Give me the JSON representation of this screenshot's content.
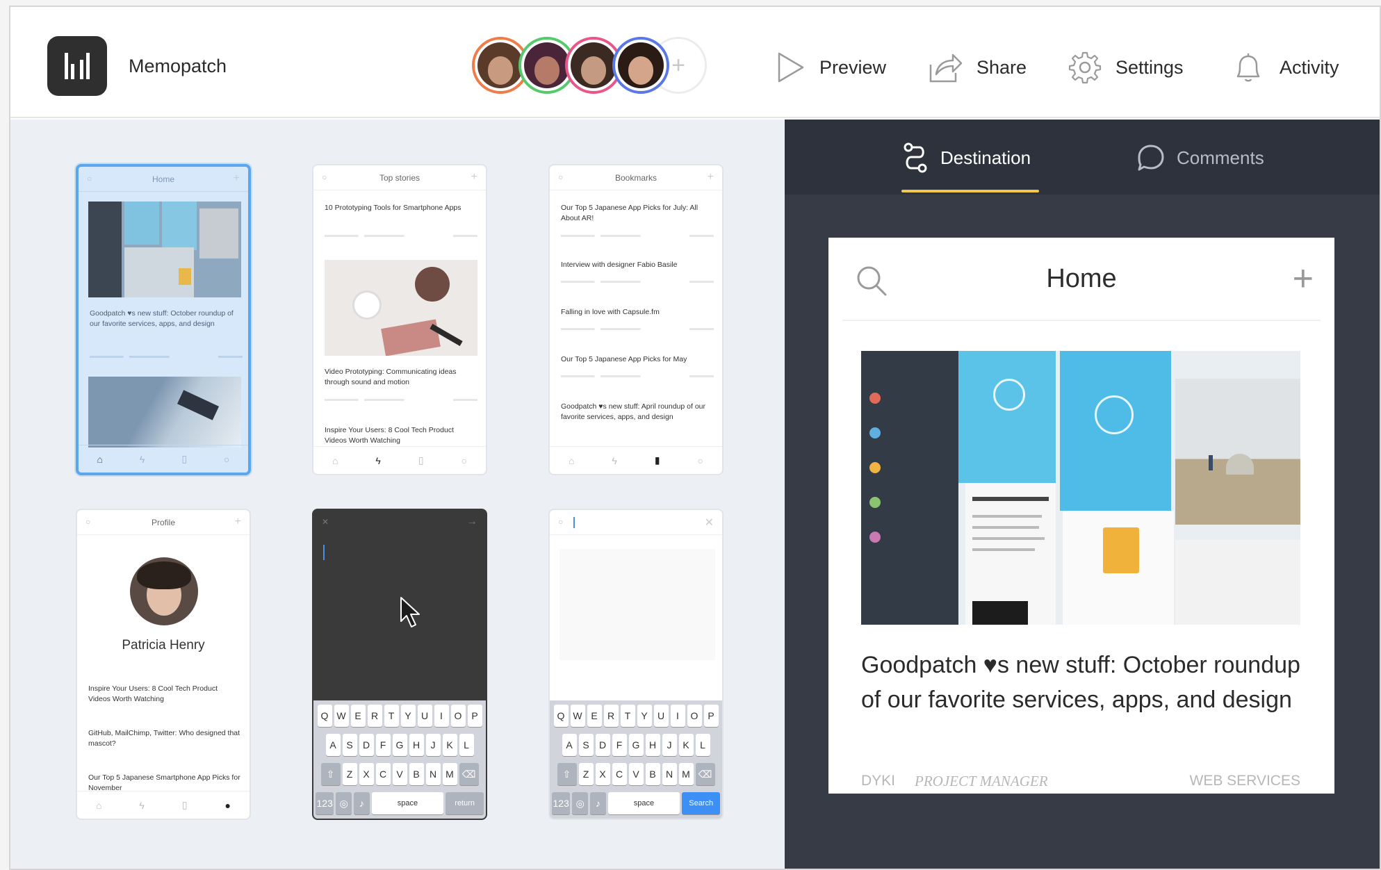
{
  "app": {
    "name": "Memopatch"
  },
  "toolbar": {
    "preview": "Preview",
    "share": "Share",
    "settings": "Settings",
    "activity": "Activity",
    "add_collaborator": "+"
  },
  "collaborators": [
    {
      "ring": "#ee7d4a",
      "skin": "#c89a80",
      "hair": "#5a3b2a"
    },
    {
      "ring": "#55c96b",
      "skin": "#b57a68",
      "hair": "#4a2438"
    },
    {
      "ring": "#e8578a",
      "skin": "#c49a82",
      "hair": "#3a2a22"
    },
    {
      "ring": "#5a78e6",
      "skin": "#d4a48b",
      "hair": "#2a1c14"
    }
  ],
  "screens": {
    "home": {
      "title": "Home",
      "headline": "Goodpatch ♥s new stuff: October roundup of our favorite services, apps, and design"
    },
    "top_stories": {
      "title": "Top stories",
      "items": [
        "10 Prototyping Tools for Smartphone Apps",
        "Video Prototyping: Communicating ideas through sound and motion",
        "Inspire Your Users: 8 Cool Tech Product Videos Worth Watching"
      ]
    },
    "bookmarks": {
      "title": "Bookmarks",
      "items": [
        "Our Top 5 Japanese App Picks for July: All About AR!",
        "Interview with designer Fabio Basile",
        "Falling in love with Capsule.fm",
        "Our Top 5 Japanese App Picks for May",
        "Goodpatch ♥s new stuff: April roundup of our favorite services, apps, and design"
      ]
    },
    "profile": {
      "title": "Profile",
      "name": "Patricia Henry",
      "items": [
        "Inspire Your Users: 8 Cool Tech Product Videos Worth Watching",
        "GitHub, MailChimp, Twitter: Who designed that mascot?",
        "Our Top 5 Japanese Smartphone App Picks for November"
      ]
    }
  },
  "keyboard": {
    "row1": [
      "Q",
      "W",
      "E",
      "R",
      "T",
      "Y",
      "U",
      "I",
      "O",
      "P"
    ],
    "row2": [
      "A",
      "S",
      "D",
      "F",
      "G",
      "H",
      "J",
      "K",
      "L"
    ],
    "row3": [
      "Z",
      "X",
      "C",
      "V",
      "B",
      "N",
      "M"
    ],
    "num": "123",
    "space": "space",
    "return": "return",
    "search": "Search"
  },
  "panel": {
    "tabs": {
      "destination": "Destination",
      "comments": "Comments"
    },
    "active_tab": "destination",
    "accent": "#f2c94c",
    "preview": {
      "title": "Home",
      "headline": "Goodpatch ♥s new stuff: October roundup of our favorite services, apps, and design",
      "tags": [
        "DYKI",
        "PROJECT MANAGER",
        "WEB SERVICES"
      ]
    }
  }
}
